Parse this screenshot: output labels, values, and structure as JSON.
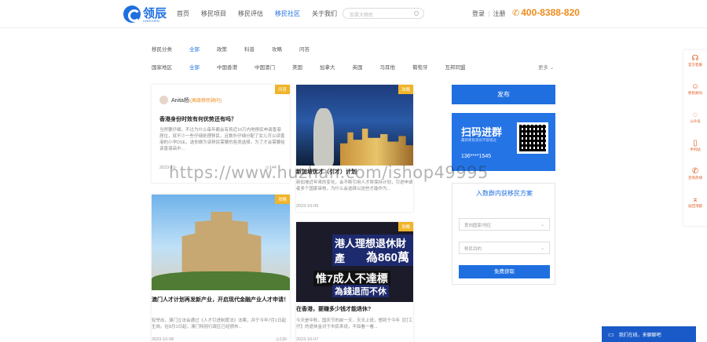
{
  "header": {
    "logo_text": "领辰",
    "logo_sub": "LINGCHEN",
    "nav": [
      "首页",
      "移民项目",
      "移民评估",
      "移民社区",
      "关于我们"
    ],
    "nav_active": "移民社区",
    "search_placeholder": "加拿大移民",
    "login": "登录",
    "register": "注册",
    "divider": "|",
    "phone": "400-8388-820",
    "phone_icon": "phone-icon"
  },
  "filters": {
    "category_label": "移民分类",
    "categories": [
      "全部",
      "政策",
      "科普",
      "攻略",
      "问答"
    ],
    "region_label": "国家地区",
    "regions": [
      "全部",
      "中国香港",
      "中国澳门",
      "美国",
      "加拿大",
      "英国",
      "马耳他",
      "葡萄牙",
      "互邦同盟"
    ],
    "more": "更多"
  },
  "cards": [
    {
      "author": "Anita杨",
      "author_tag": "(高级移民顾问)",
      "tag": "问答",
      "title": "香港身份时效有何优势还有吗？",
      "excerpt": "当然要仔细，不过为什么每年都会有将近10万内地移民申请香港居住，就不少一些仔细处理移民，且数外仔细分配了女儿可以读香港的小学DSE，选你做为该移民需要的各类选择，为了才会需要给该香港高中...",
      "date": "2023-10-",
      "views": "144"
    },
    {
      "tag": "攻略",
      "title": "新加坡优才（引才）计划",
      "excerpt": "新加坡近年来的变化，会不断引用人才将保持计划，引进申请者多个国家审核，为什么会选择以这些才能作为...",
      "date": "2023-10-09",
      "views": "149"
    },
    {
      "tag": "攻略",
      "title": "澳门人才计划再发新产业，开启现代金融产业人才申请！",
      "excerpt": "轻举出，澳门立法会通过《人才引进制度法》法案，并于今年7月1日起生效。在8月1日起，澳门特别行政区已经颁布...",
      "date": "2023-10-08",
      "views": "130"
    },
    {
      "tag": "攻略",
      "title": "在香港，要赚多少钱才能退休?",
      "excerpt": "今天是中秋，国庆节的前一天，天天上班，想到于今年【打工仔】的退休金对于市民来说，不如看一看...",
      "date": "2023-10-07",
      "views": "134",
      "image_text": [
        "港人理想退休財產",
        "為860萬",
        "惟7成人不達標",
        "為錢退而不休"
      ]
    }
  ],
  "side": {
    "publish": "发布",
    "qr_title": "扫码进群",
    "qr_sub": "最新移民资讯不容错过",
    "qr_phone": "136****1545",
    "form_title": "入数群内获移民方案",
    "select_country": "意向国家/地区",
    "select_goal": "移民目的",
    "submit": "免费获取"
  },
  "float_sidebar": [
    {
      "icon": "headset-icon",
      "label": "官方客服"
    },
    {
      "icon": "user-icon",
      "label": "移民顾问"
    },
    {
      "icon": "wechat-icon",
      "label": "公众号"
    },
    {
      "icon": "mobile-icon",
      "label": "手机站"
    },
    {
      "icon": "phone-icon",
      "label": "咨询热线"
    },
    {
      "icon": "top-icon",
      "label": "返回顶部"
    }
  ],
  "chat": {
    "label": "我们在线，来聊聊吧",
    "icon": "chat-icon"
  },
  "watermark": "https://www.huzhan.com/ishop49995",
  "colors": {
    "brand": "#1f6fe0",
    "accent": "#f08a1c",
    "tag": "#f0b429"
  }
}
